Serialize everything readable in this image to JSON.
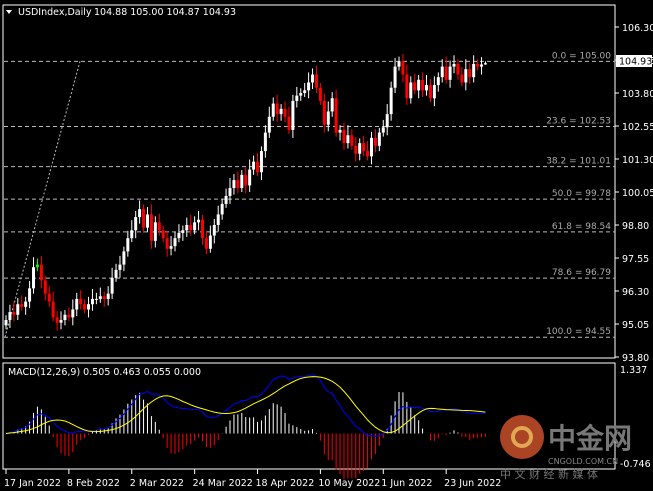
{
  "header": {
    "symbol_label": "USDIndex,Daily",
    "ohlc_label": "104.88 105.00 104.87 104.93"
  },
  "macd_header": "MACD(12,26,9) 0.505 0.463 0.055 0.000",
  "current_price_label": "104.93",
  "watermark": {
    "logo_text": "中金网",
    "domain": "CNGOLD.COM.CN",
    "slogan": "中 文 财 经 新 媒 体"
  },
  "colors": {
    "background": "#000000",
    "bull_candle": "#ffffff",
    "bear_candle": "#ff0000",
    "doji_highlight": "#00ff00",
    "macd_line": "#0000ff",
    "signal_line": "#ffff00",
    "hist_positive": "#ffffff",
    "hist_negative": "#ff0000",
    "fib_lines": "#bbbbbb"
  },
  "chart_data": [
    {
      "type": "candlestick",
      "title": "USDIndex,Daily",
      "ylim": [
        93.8,
        106.3
      ],
      "y_ticks": [
        "106.30",
        "105.05",
        "103.80",
        "102.55",
        "101.30",
        "100.05",
        "98.80",
        "97.55",
        "96.30",
        "95.05",
        "93.80"
      ],
      "x_ticks": [
        {
          "index": 0,
          "label": "17 Jan 2022"
        },
        {
          "index": 16,
          "label": "8 Feb 2022"
        },
        {
          "index": 32,
          "label": "2 Mar 2022"
        },
        {
          "index": 48,
          "label": "24 Mar 2022"
        },
        {
          "index": 64,
          "label": "18 Apr 2022"
        },
        {
          "index": 80,
          "label": "10 May 2022"
        },
        {
          "index": 96,
          "label": "1 Jun 2022"
        },
        {
          "index": 112,
          "label": "23 Jun 2022"
        }
      ],
      "close": [
        95.2,
        95.5,
        95.4,
        95.8,
        95.7,
        95.9,
        96.4,
        97.2,
        97.3,
        96.7,
        96.2,
        95.9,
        95.3,
        95.1,
        95.2,
        95.4,
        95.3,
        95.6,
        96.0,
        95.8,
        95.6,
        95.8,
        96.0,
        96.0,
        96.1,
        96.0,
        96.2,
        96.8,
        97.1,
        97.3,
        97.8,
        98.3,
        98.6,
        99.1,
        99.4,
        98.7,
        99.2,
        98.2,
        98.9,
        98.6,
        98.3,
        97.9,
        98.0,
        98.3,
        98.5,
        98.6,
        98.8,
        98.6,
        98.9,
        99.0,
        98.3,
        97.9,
        98.4,
        98.8,
        99.2,
        99.6,
        99.9,
        100.2,
        100.5,
        100.2,
        100.7,
        100.3,
        100.9,
        101.2,
        100.8,
        101.6,
        102.3,
        102.9,
        103.4,
        103.0,
        103.2,
        102.9,
        102.4,
        103.5,
        103.7,
        103.8,
        103.9,
        104.2,
        104.5,
        104.0,
        103.5,
        102.6,
        103.1,
        103.6,
        102.3,
        102.4,
        101.9,
        102.2,
        101.8,
        101.5,
        101.9,
        101.6,
        101.4,
        102.1,
        101.8,
        102.3,
        102.5,
        103.0,
        104.0,
        104.8,
        105.0,
        104.5,
        103.6,
        104.2,
        103.9,
        104.3,
        103.9,
        104.1,
        103.6,
        104.1,
        104.4,
        104.8,
        104.3,
        104.8,
        104.9,
        104.5,
        104.2,
        104.7,
        104.4,
        104.9,
        104.8,
        104.88,
        104.93
      ],
      "last_bar": {
        "open": 104.88,
        "high": 105.0,
        "low": 104.87,
        "close": 104.93
      },
      "fibonacci": [
        {
          "level": "0.0",
          "price": 105.0,
          "label": "0.0 = 105.00"
        },
        {
          "level": "23.6",
          "price": 102.53,
          "label": "23.6 = 102.53"
        },
        {
          "level": "38.2",
          "price": 101.01,
          "label": "38.2 = 101.01"
        },
        {
          "level": "50.0",
          "price": 99.78,
          "label": "50.0 = 99.78"
        },
        {
          "level": "61.8",
          "price": 98.54,
          "label": "61.8 = 98.54"
        },
        {
          "level": "78.6",
          "price": 96.79,
          "label": "78.6 = 96.79"
        },
        {
          "level": "100.0",
          "price": 94.55,
          "label": "100.0 = 94.55"
        }
      ],
      "fib_trendline": {
        "from_price": 94.55,
        "to_price": 105.0
      }
    },
    {
      "type": "line+bar",
      "title": "MACD(12,26,9) 0.505 0.463 0.055 0.000",
      "params": [
        12,
        26,
        9
      ],
      "ylim": [
        -0.746,
        1.337
      ],
      "y_ticks": [
        "1.337",
        "-0.746"
      ],
      "values": {
        "macd": 0.505,
        "signal": 0.463,
        "histogram": 0.055,
        "extra": 0.0
      }
    }
  ]
}
